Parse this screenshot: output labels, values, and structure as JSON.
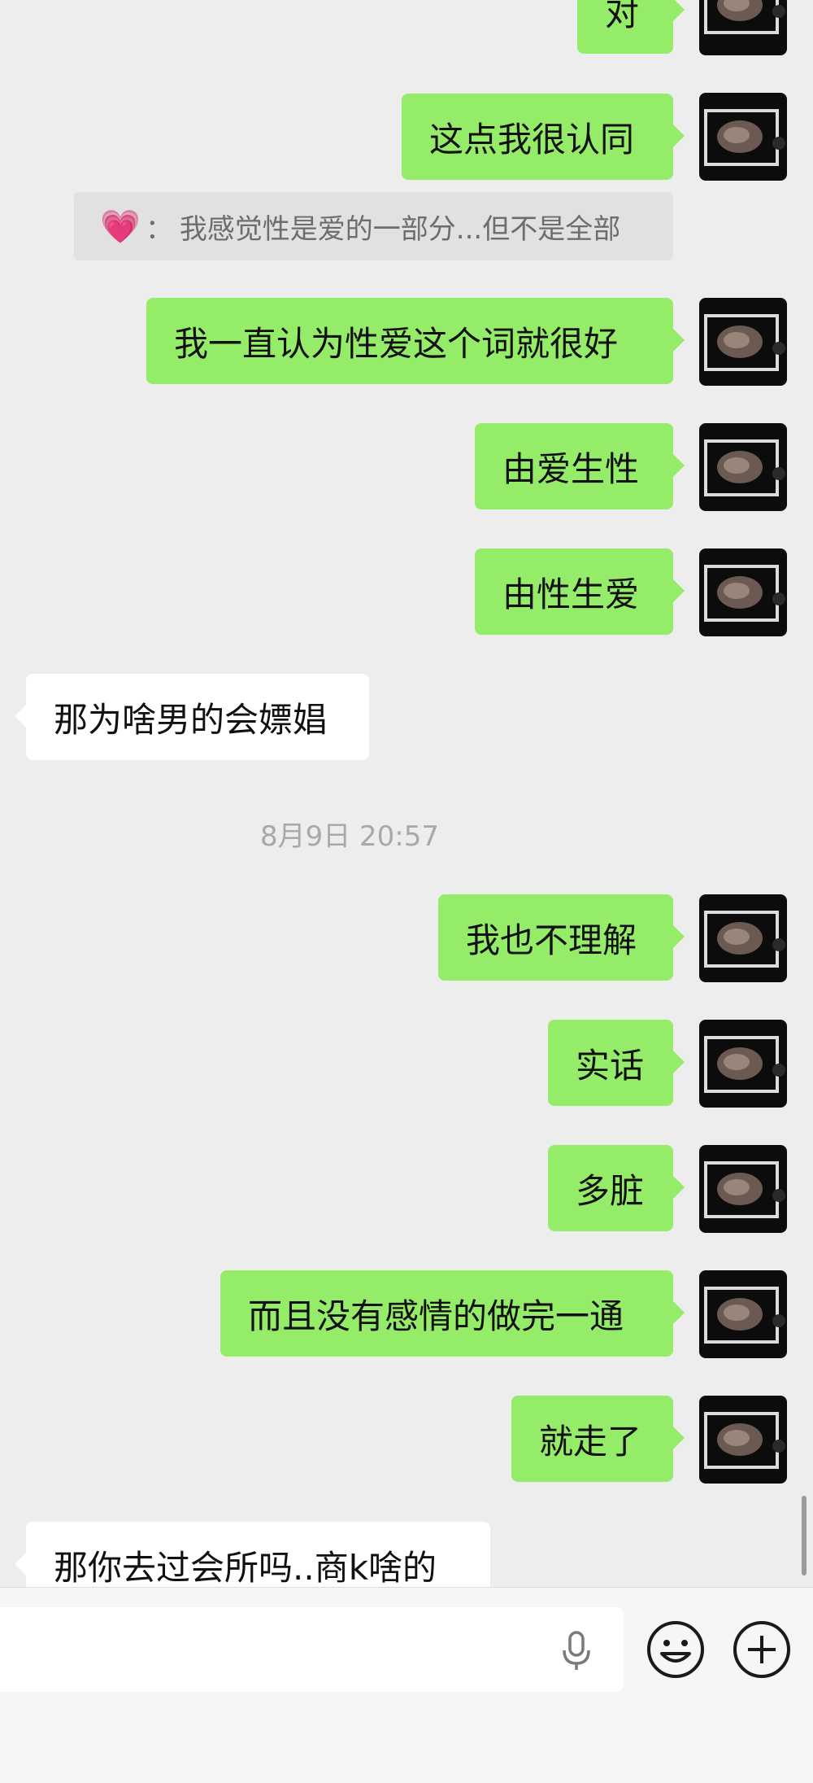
{
  "messages_top": [
    {
      "side": "out",
      "text": "对"
    },
    {
      "side": "out",
      "text": "这点我很认同"
    }
  ],
  "quote": {
    "author_icon": "pink-heart-emoji",
    "separator": "：",
    "text": "我感觉性是爱的一部分...但不是全部"
  },
  "messages_mid": [
    {
      "side": "out",
      "text": "我一直认为性爱这个词就很好"
    },
    {
      "side": "out",
      "text": "由爱生性"
    },
    {
      "side": "out",
      "text": "由性生爱"
    },
    {
      "side": "in",
      "text": "那为啥男的会嫖娼"
    }
  ],
  "timestamp": "8月9日 20:57",
  "messages_bottom": [
    {
      "side": "out",
      "text": "我也不理解"
    },
    {
      "side": "out",
      "text": "实话"
    },
    {
      "side": "out",
      "text": "多脏"
    },
    {
      "side": "out",
      "text": "而且没有感情的做完一通"
    },
    {
      "side": "out",
      "text": "就走了"
    },
    {
      "side": "in",
      "text": "那你去过会所吗..商k啥的"
    }
  ],
  "input": {
    "value": "",
    "icons": [
      "microphone-icon",
      "emoji-icon",
      "plus-icon"
    ]
  },
  "colors": {
    "background": "#ededed",
    "outgoing_bubble": "#95ec69",
    "incoming_bubble": "#ffffff",
    "text": "#111111",
    "timestamp": "#a8a8a8"
  }
}
